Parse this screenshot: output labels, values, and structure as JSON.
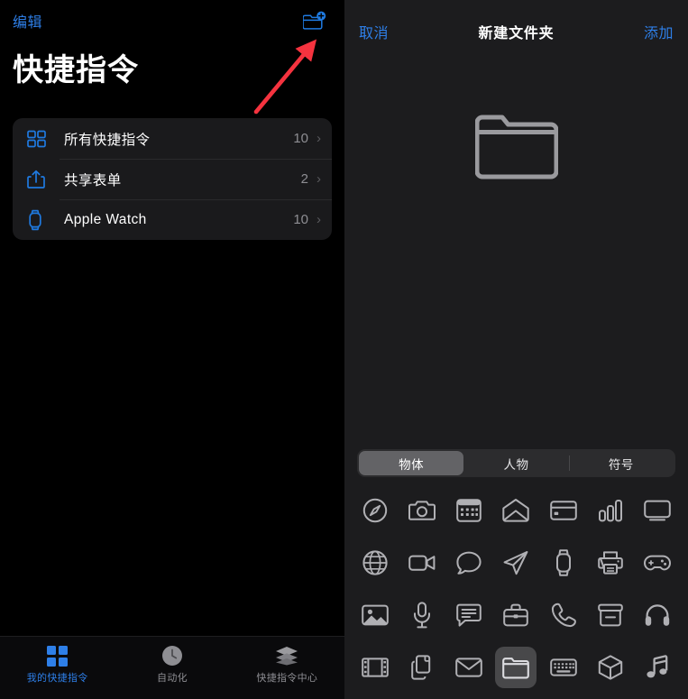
{
  "colors": {
    "accent_blue": "#2e7fe8",
    "left_bg": "#000000",
    "right_bg": "#1c1c1e",
    "card_bg": "#1a1a1c",
    "icon_stroke": "#b0b0b4",
    "selected_cell": "#48484a",
    "annotation_red": "#f5333f",
    "secondary_text": "#8e8e93"
  },
  "left": {
    "edit_label": "编辑",
    "new_folder_icon": "folder-add-icon",
    "title": "快捷指令",
    "list": [
      {
        "icon": "grid-squares-icon",
        "label": "所有快捷指令",
        "count": "10",
        "chevron": "›"
      },
      {
        "icon": "share-icon",
        "label": "共享表单",
        "count": "2",
        "chevron": "›"
      },
      {
        "icon": "apple-watch-icon",
        "label": "Apple Watch",
        "count": "10",
        "chevron": "›"
      }
    ],
    "tabs": [
      {
        "icon": "grid-squares-icon",
        "label": "我的快捷指令",
        "active": true
      },
      {
        "icon": "clock-icon",
        "label": "自动化",
        "active": false
      },
      {
        "icon": "layers-icon",
        "label": "快捷指令中心",
        "active": false
      }
    ]
  },
  "right": {
    "cancel_label": "取消",
    "title": "新建文件夹",
    "add_label": "添加",
    "preview_icon": "folder-icon",
    "segments": [
      {
        "label": "物体",
        "selected": true
      },
      {
        "label": "人物",
        "selected": false
      },
      {
        "label": "符号",
        "selected": false
      }
    ],
    "icons": [
      {
        "name": "compass-icon",
        "selected": false
      },
      {
        "name": "camera-icon",
        "selected": false
      },
      {
        "name": "calculator-icon",
        "selected": false
      },
      {
        "name": "open-envelope-icon",
        "selected": false
      },
      {
        "name": "credit-card-icon",
        "selected": false
      },
      {
        "name": "bar-chart-icon",
        "selected": false
      },
      {
        "name": "monitor-icon",
        "selected": false
      },
      {
        "name": "globe-icon",
        "selected": false
      },
      {
        "name": "video-camera-icon",
        "selected": false
      },
      {
        "name": "speech-bubble-icon",
        "selected": false
      },
      {
        "name": "paper-plane-icon",
        "selected": false
      },
      {
        "name": "apple-watch-icon",
        "selected": false
      },
      {
        "name": "printer-icon",
        "selected": false
      },
      {
        "name": "game-controller-icon",
        "selected": false
      },
      {
        "name": "photo-icon",
        "selected": false
      },
      {
        "name": "microphone-icon",
        "selected": false
      },
      {
        "name": "text-bubble-icon",
        "selected": false
      },
      {
        "name": "briefcase-icon",
        "selected": false
      },
      {
        "name": "phone-icon",
        "selected": false
      },
      {
        "name": "archive-box-icon",
        "selected": false
      },
      {
        "name": "headphones-icon",
        "selected": false
      },
      {
        "name": "film-icon",
        "selected": false
      },
      {
        "name": "documents-icon",
        "selected": false
      },
      {
        "name": "envelope-icon",
        "selected": false
      },
      {
        "name": "folder-icon",
        "selected": true
      },
      {
        "name": "keyboard-icon",
        "selected": false
      },
      {
        "name": "cube-icon",
        "selected": false
      },
      {
        "name": "music-note-icon",
        "selected": false
      }
    ]
  },
  "annotation": {
    "type": "arrow",
    "color": "#f5333f",
    "points_to": "folder-add-button"
  }
}
